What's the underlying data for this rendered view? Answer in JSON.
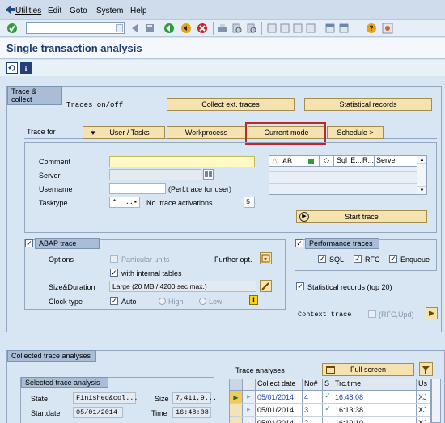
{
  "menu": [
    "Utilities",
    "Edit",
    "Goto",
    "System",
    "Help"
  ],
  "title": "Single transaction analysis",
  "trace_collect": {
    "header": "Trace & collect",
    "traces_label": "Traces on/off",
    "collect_btn": "Collect ext. traces",
    "stat_btn": "Statistical records",
    "trace_for": "Trace for",
    "tabs": [
      "User / Tasks",
      "Workprocess",
      "Current mode",
      "Schedule >"
    ],
    "comment_label": "Comment",
    "server_label": "Server",
    "username_label": "Username",
    "username_hint": "(Perf.trace for user)",
    "tasktype_label": "Tasktype",
    "tasktype_value": "*",
    "no_trace_label": "No. trace activations",
    "no_trace_value": "5",
    "grid_headers": [
      "AB...",
      "",
      "",
      "Sql",
      "E...",
      "R...",
      "Server"
    ],
    "start_trace": "Start trace"
  },
  "abap": {
    "header": "ABAP trace",
    "options": "Options",
    "particular": "Particular units",
    "further": "Further opt.",
    "internal_tables": "with internal tables",
    "size_label": "Size&Duration",
    "size_value": "Large (20 MB / 4200 sec max.)",
    "clock_label": "Clock type",
    "auto": "Auto",
    "high": "High",
    "low": "Low"
  },
  "perf": {
    "header": "Performance traces",
    "sql": "SQL",
    "rfc": "RFC",
    "enqueue": "Enqueue",
    "stat_records": "Statistical records (top 20)",
    "context_label": "Context trace",
    "rfc_upd": "(RFC,Upd)"
  },
  "collected": {
    "header": "Collected trace analyses",
    "trace_analyses": "Trace analyses",
    "full_screen": "Full screen",
    "selected_header": "Selected trace analysis",
    "state_label": "State",
    "state_value": "Finished&col...",
    "size_label": "Size",
    "size_value": "7,411,9...",
    "startdate_label": "Startdate",
    "startdate_value": "05/01/2014",
    "time_label": "Time",
    "time_value": "16:48:08",
    "table_headers": [
      "Collect date",
      "No#",
      "S",
      "Trc.time",
      "Us"
    ],
    "rows": [
      {
        "date": "05/01/2014",
        "no": "4",
        "time": "16:48:08",
        "user": "XJ"
      },
      {
        "date": "05/01/2014",
        "no": "3",
        "time": "16:13:38",
        "user": "XJ"
      },
      {
        "date": "05/01/2014",
        "no": "2",
        "time": "16:10:10",
        "user": "XJ"
      }
    ]
  },
  "colors": {
    "highlight": "#c0272d",
    "accent": "#1e3a6e"
  }
}
